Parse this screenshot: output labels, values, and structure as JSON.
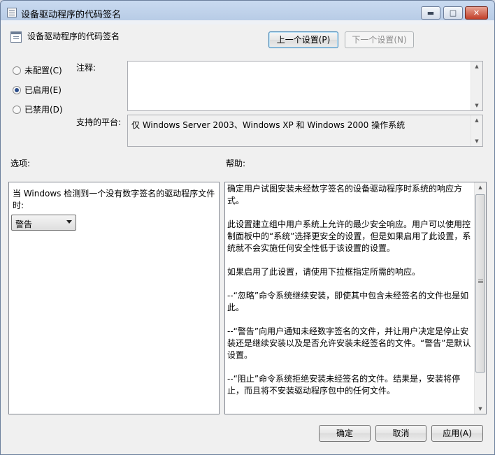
{
  "window": {
    "title": "设备驱动程序的代码签名",
    "controls": {
      "minimize": "▬",
      "maximize": "□",
      "close": "✕"
    }
  },
  "policy": {
    "name": "设备驱动程序的代码签名",
    "prev_button": "上一个设置(P)",
    "next_button": "下一个设置(N)"
  },
  "state": {
    "options": [
      {
        "label": "未配置(C)",
        "checked": false
      },
      {
        "label": "已启用(E)",
        "checked": true
      },
      {
        "label": "已禁用(D)",
        "checked": false
      }
    ]
  },
  "comment": {
    "label": "注释:",
    "value": ""
  },
  "platform": {
    "label": "支持的平台:",
    "value": "仅 Windows Server 2003、Windows XP 和 Windows 2000 操作系统"
  },
  "options_section": {
    "label": "选项:",
    "prompt": "当 Windows 检测到一个没有数字签名的驱动程序文件时:",
    "selected": "警告"
  },
  "help_section": {
    "label": "帮助:",
    "paragraphs": [
      "确定用户试图安装未经数字签名的设备驱动程序时系统的响应方式。",
      "",
      "此设置建立组中用户系统上允许的最少安全响应。用户可以使用控制面板中的“系统”选择更安全的设置，但是如果启用了此设置，系统就不会实施任何安全性低于该设置的设置。",
      "",
      "如果启用了此设置，请使用下拉框指定所需的响应。",
      "",
      "--“忽略”命令系统继续安装，即使其中包含未经签名的文件也是如此。",
      "",
      "--“警告”向用户通知未经数字签名的文件，并让用户决定是停止安装还是继续安装以及是否允许安装未经签名的文件。“警告”是默认设置。",
      "",
      "--“阻止”命令系统拒绝安装未经签名的文件。结果是，安装将停止，而且将不安装驱动程序包中的任何文件。"
    ]
  },
  "footer": {
    "ok": "确定",
    "cancel": "取消",
    "apply": "应用(A)"
  },
  "icons": {
    "title": "policy-setting-icon",
    "header": "policy-setting-icon",
    "scroll_up": "▲",
    "scroll_down": "▼"
  }
}
